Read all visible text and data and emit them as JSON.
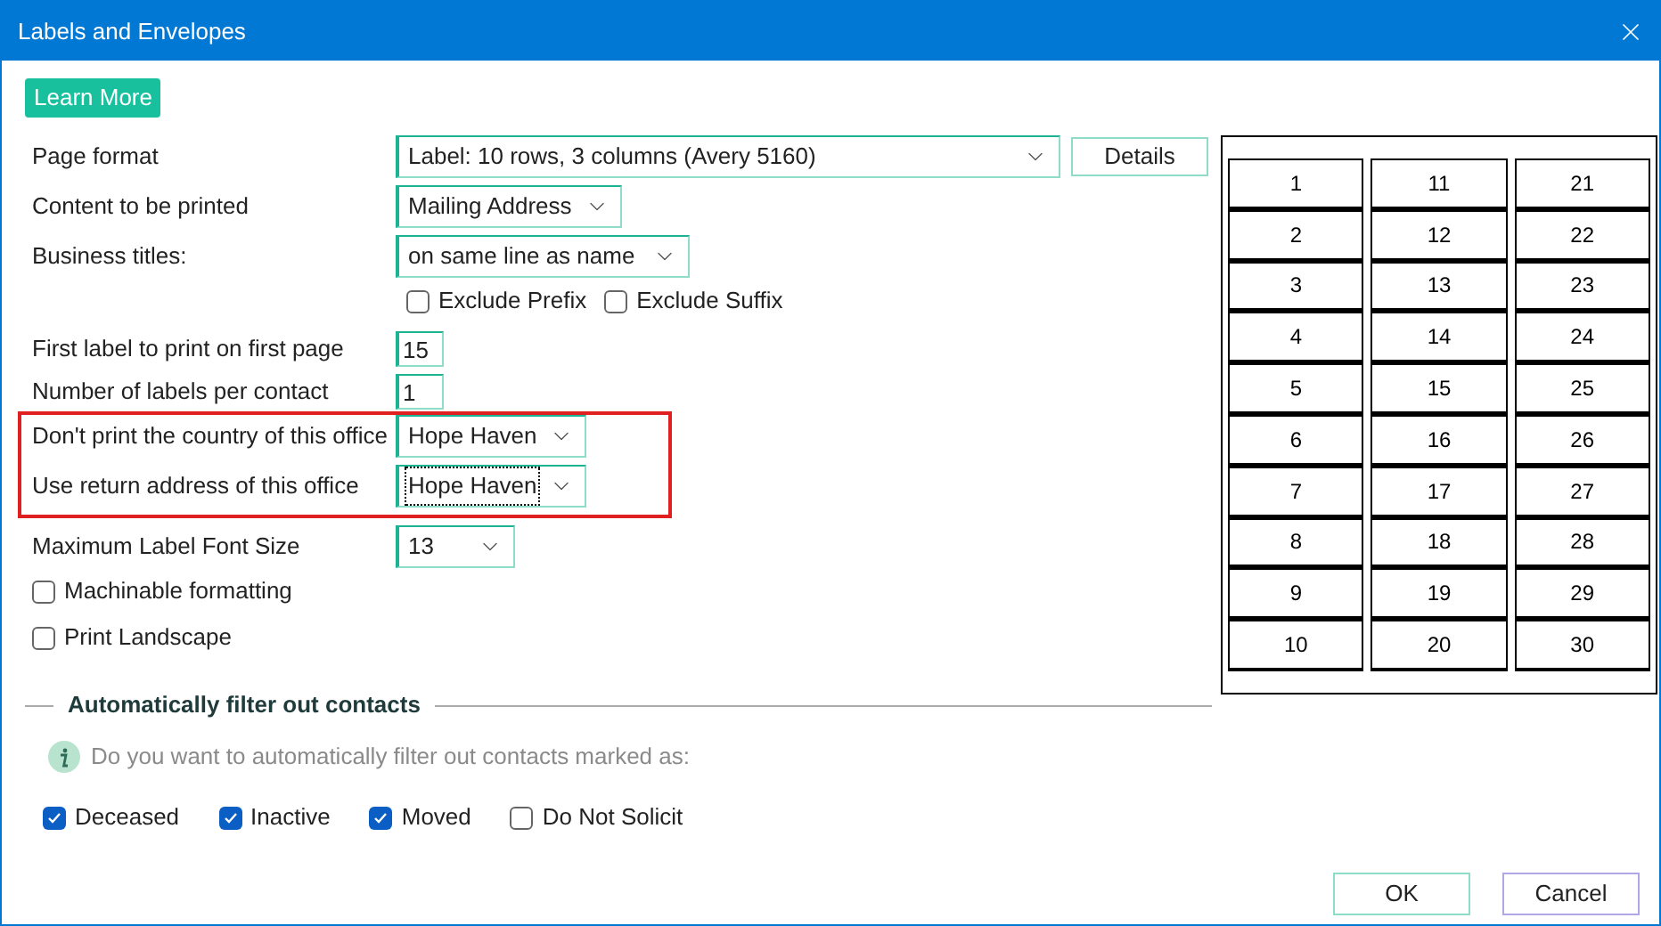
{
  "window": {
    "title": "Labels and Envelopes"
  },
  "learn_more": "Learn More",
  "form_rows": [
    {
      "kind": "select",
      "label": "Page format",
      "value": "Label: 10 rows, 3 columns (Avery 5160)",
      "button": "Details",
      "highlighted": false,
      "focused": false
    },
    {
      "kind": "select",
      "label": "Content to be printed",
      "value": "Mailing Address",
      "highlighted": false,
      "focused": false
    },
    {
      "kind": "select",
      "label": "Business titles:",
      "value": "on same line as name",
      "highlighted": false,
      "focused": false
    },
    {
      "kind": "checks",
      "options": [
        {
          "label": "Exclude Prefix",
          "checked": false
        },
        {
          "label": "Exclude Suffix",
          "checked": false
        }
      ],
      "highlighted": false
    },
    {
      "kind": "input",
      "label": "First label to print on first page",
      "value": "15",
      "highlighted": false
    },
    {
      "kind": "input",
      "label": "Number of labels per contact",
      "value": "1",
      "highlighted": false
    },
    {
      "kind": "select",
      "label": "Don't print the country of this office",
      "value": "Hope Haven",
      "highlighted": true,
      "focused": false
    },
    {
      "kind": "select",
      "label": "Use return address of this office",
      "value": "Hope Haven",
      "highlighted": true,
      "focused": true
    },
    {
      "kind": "select",
      "label": "Maximum Label Font Size",
      "value": "13",
      "highlighted": false,
      "focused": false
    },
    {
      "kind": "checkbox",
      "label": "Machinable formatting",
      "checked": false,
      "highlighted": false
    },
    {
      "kind": "checkbox",
      "label": "Print Landscape",
      "checked": false,
      "highlighted": false
    }
  ],
  "label_sheet": {
    "cells": [
      "1",
      "2",
      "3",
      "4",
      "5",
      "6",
      "7",
      "8",
      "9",
      "10",
      "11",
      "12",
      "13",
      "14",
      "15",
      "16",
      "17",
      "18",
      "19",
      "20",
      "21",
      "22",
      "23",
      "24",
      "25",
      "26",
      "27",
      "28",
      "29",
      "30"
    ]
  },
  "filter": {
    "title": "Automatically filter out contacts",
    "info": "Do you want to automatically filter out contacts marked as:",
    "options": [
      {
        "label": "Deceased",
        "checked": true
      },
      {
        "label": "Inactive",
        "checked": true
      },
      {
        "label": "Moved",
        "checked": true
      },
      {
        "label": "Do Not Solicit",
        "checked": false
      }
    ]
  },
  "buttons": [
    "OK",
    "Cancel"
  ]
}
